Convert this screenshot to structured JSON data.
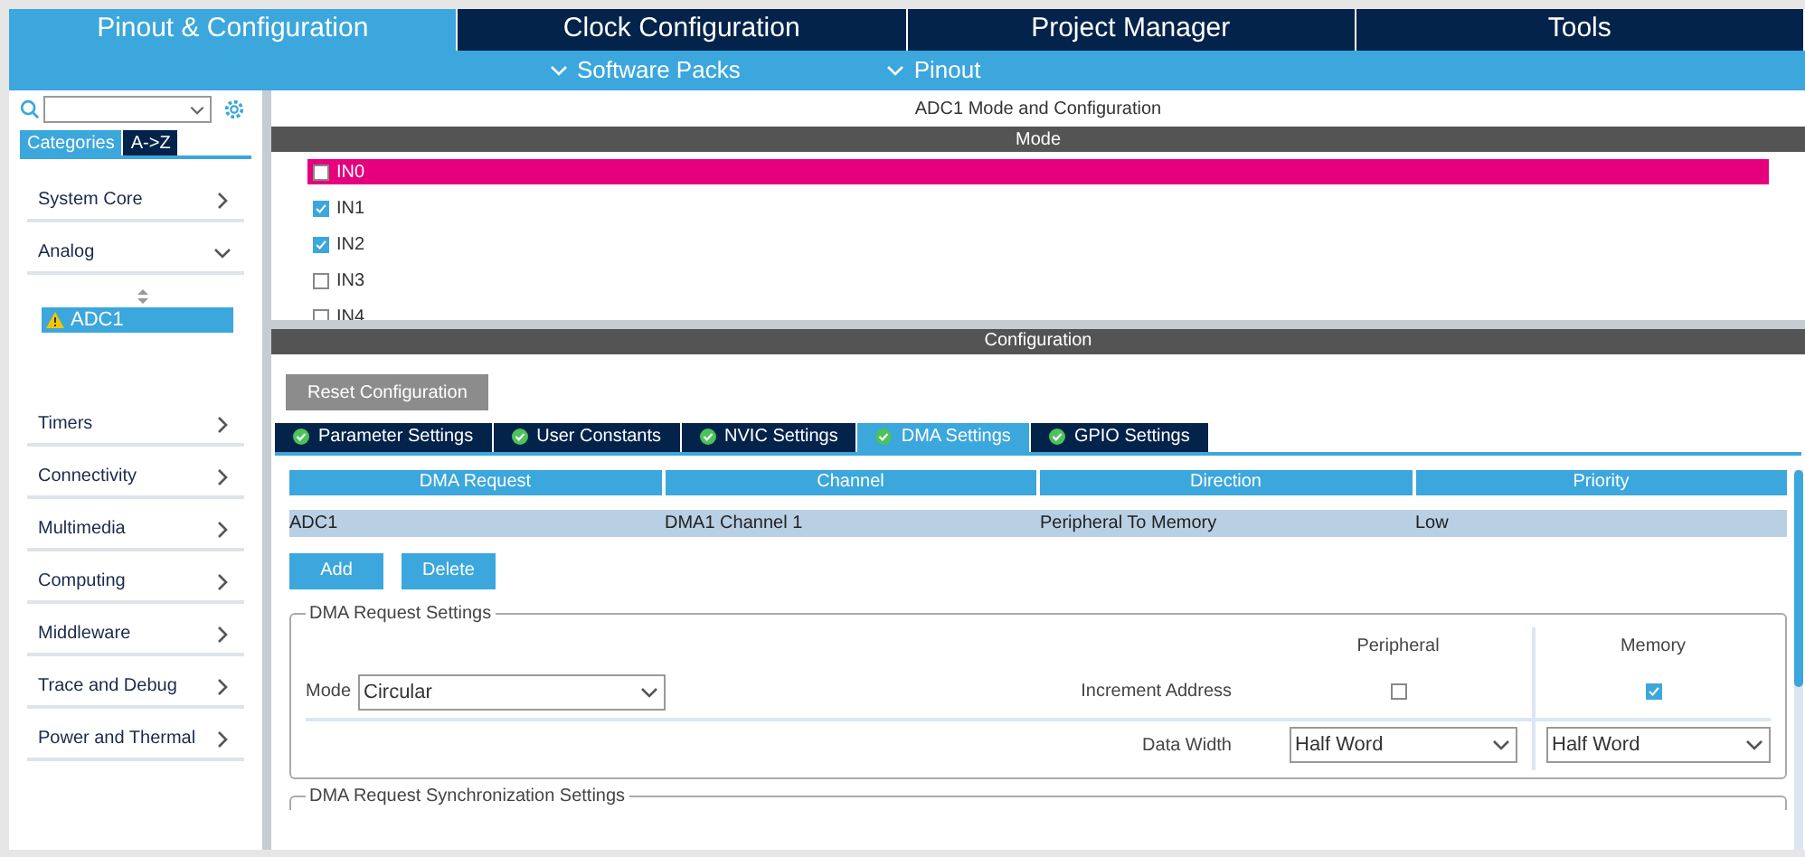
{
  "top_tabs": [
    {
      "label": "Pinout & Configuration",
      "selected": true
    },
    {
      "label": "Clock Configuration",
      "selected": false
    },
    {
      "label": "Project Manager",
      "selected": false
    },
    {
      "label": "Tools",
      "selected": false
    }
  ],
  "sub_menus": [
    "Software Packs",
    "Pinout"
  ],
  "sidebar": {
    "view_tabs": [
      {
        "label": "Categories",
        "selected": true
      },
      {
        "label": "A->Z",
        "selected": false
      }
    ],
    "categories": [
      {
        "label": "System Core",
        "expanded": false
      },
      {
        "label": "Analog",
        "expanded": true,
        "children": [
          {
            "label": "ADC1",
            "selected": true,
            "warning": true
          }
        ]
      },
      {
        "label": "Timers",
        "expanded": false
      },
      {
        "label": "Connectivity",
        "expanded": false
      },
      {
        "label": "Multimedia",
        "expanded": false
      },
      {
        "label": "Computing",
        "expanded": false
      },
      {
        "label": "Middleware",
        "expanded": false
      },
      {
        "label": "Trace and Debug",
        "expanded": false
      },
      {
        "label": "Power and Thermal",
        "expanded": false
      }
    ]
  },
  "panel_title": "ADC1 Mode and Configuration",
  "mode": {
    "header": "Mode",
    "channels": [
      {
        "label": "IN0",
        "checked": false,
        "selected": true
      },
      {
        "label": "IN1",
        "checked": true,
        "selected": false
      },
      {
        "label": "IN2",
        "checked": true,
        "selected": false
      },
      {
        "label": "IN3",
        "checked": false,
        "selected": false
      },
      {
        "label": "IN4",
        "checked": false,
        "selected": false
      }
    ]
  },
  "configuration": {
    "header": "Configuration",
    "reset_button": "Reset Configuration",
    "tabs": [
      {
        "label": "Parameter Settings",
        "selected": false
      },
      {
        "label": "User Constants",
        "selected": false
      },
      {
        "label": "NVIC Settings",
        "selected": false
      },
      {
        "label": "DMA Settings",
        "selected": true
      },
      {
        "label": "GPIO Settings",
        "selected": false
      }
    ],
    "table": {
      "columns": [
        "DMA Request",
        "Channel",
        "Direction",
        "Priority"
      ],
      "rows": [
        {
          "cells": [
            "ADC1",
            "DMA1 Channel 1",
            "Peripheral To Memory",
            "Low"
          ],
          "selected": true
        }
      ]
    },
    "buttons": [
      "Add",
      "Delete"
    ],
    "request_settings": {
      "title": "DMA Request Settings",
      "mode_label": "Mode",
      "mode_value": "Circular",
      "peripheral_header": "Peripheral",
      "memory_header": "Memory",
      "increment_label": "Increment Address",
      "peripheral_increment": false,
      "memory_increment": true,
      "data_width_label": "Data Width",
      "peripheral_width": "Half Word",
      "memory_width": "Half Word"
    },
    "sync_settings_title": "DMA Request Synchronization Settings"
  }
}
